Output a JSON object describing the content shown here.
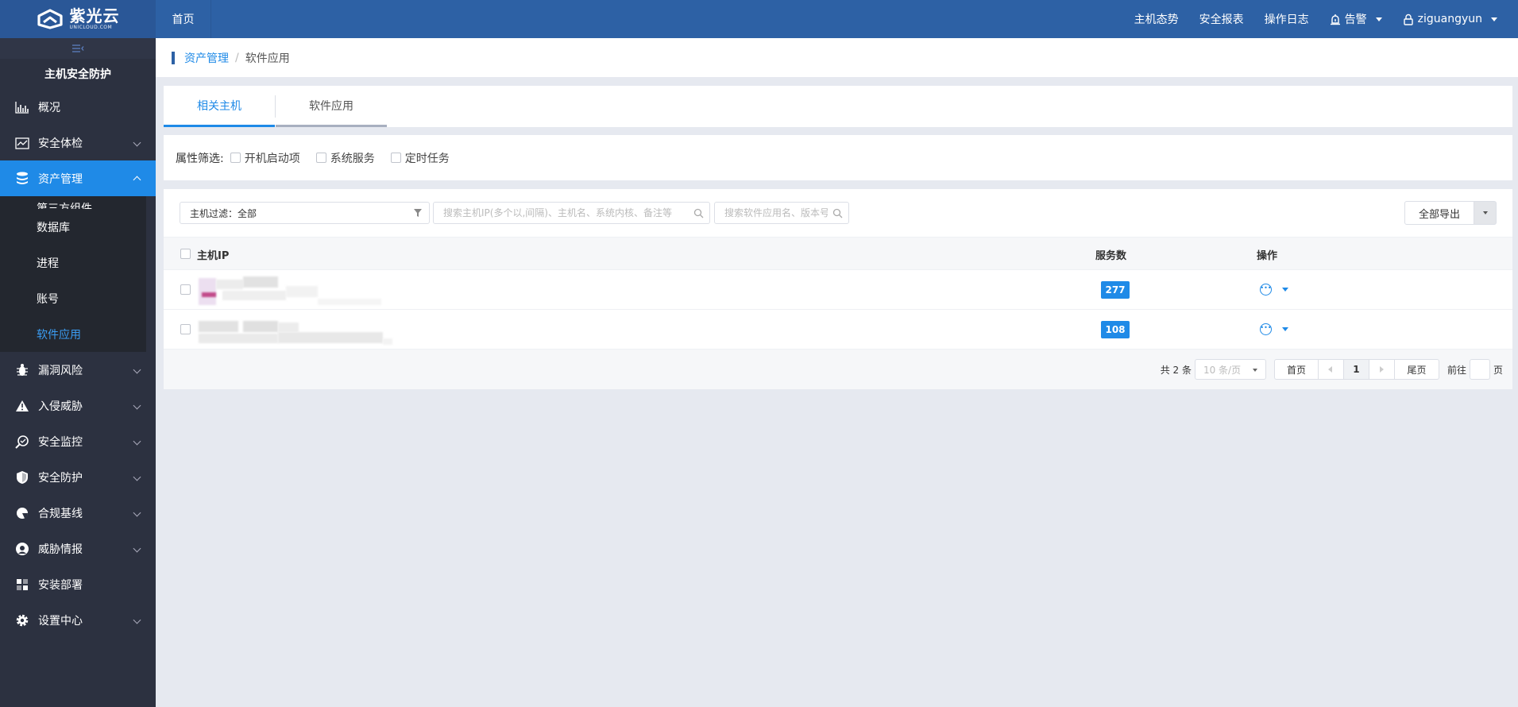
{
  "header": {
    "logo_cn": "紫光云",
    "logo_en": "UNICLOUD.COM",
    "home": "首页",
    "nav": [
      "主机态势",
      "安全报表",
      "操作日志"
    ],
    "alarm": "告警",
    "user": "ziguangyun"
  },
  "sidebar": {
    "title": "主机安全防护",
    "items": [
      {
        "label": "概况"
      },
      {
        "label": "安全体检"
      },
      {
        "label": "资产管理"
      },
      {
        "label": "漏洞风险"
      },
      {
        "label": "入侵威胁"
      },
      {
        "label": "安全监控"
      },
      {
        "label": "安全防护"
      },
      {
        "label": "合规基线"
      },
      {
        "label": "威胁情报"
      },
      {
        "label": "安装部署"
      },
      {
        "label": "设置中心"
      }
    ],
    "submenu": [
      "第三方组件",
      "数据库",
      "进程",
      "账号",
      "软件应用"
    ]
  },
  "breadcrumb": {
    "parent": "资产管理",
    "separator": "/",
    "current": "软件应用"
  },
  "tabs": [
    "相关主机",
    "软件应用"
  ],
  "filters": {
    "label": "属性筛选:",
    "options": [
      "开机启动项",
      "系统服务",
      "定时任务"
    ]
  },
  "toolbar": {
    "host_filter": "主机过滤：全部",
    "search_host_placeholder": "搜索主机IP(多个以,间隔)、主机名、系统内核、备注等",
    "search_app_placeholder": "搜索软件应用名、版本号",
    "export": "全部导出"
  },
  "table": {
    "headers": {
      "host": "主机IP",
      "services": "服务数",
      "ops": "操作"
    },
    "rows": [
      {
        "services": "277"
      },
      {
        "services": "108"
      }
    ]
  },
  "pager": {
    "total": "共 2 条",
    "page_size": "10 条/页",
    "first": "首页",
    "current": "1",
    "last": "尾页",
    "goto": "前往",
    "unit": "页"
  },
  "colors": {
    "topbar": "#2d61a5",
    "sidebar": "#2c3140",
    "accent": "#1f8ae7"
  }
}
